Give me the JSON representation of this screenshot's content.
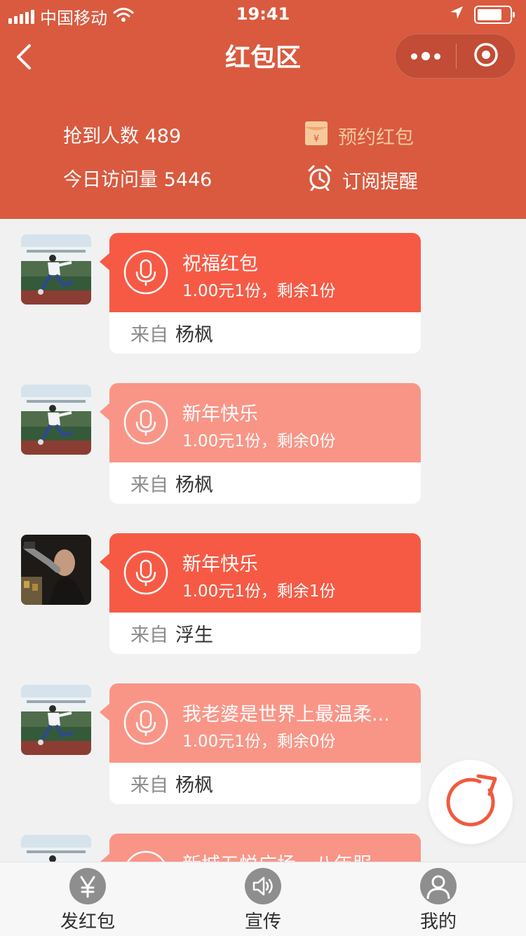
{
  "colors": {
    "header_bg": "#d95a3f",
    "packet_active": "#f65a45",
    "packet_done": "#f99587",
    "reserve_text": "#f6c99c",
    "refresh_ring": "#f05a3e"
  },
  "status_bar": {
    "carrier": "中国移动",
    "time": "19:41",
    "icons": [
      "signal-icon",
      "wifi-icon",
      "location-arrow-icon",
      "battery-icon"
    ]
  },
  "nav": {
    "title": "红包区",
    "back_icon": "chevron-left-icon",
    "menu_icon": "more-dots-icon",
    "close_icon": "target-circle-icon"
  },
  "stats": {
    "grabbed": "抢到人数 489",
    "visits": "今日访问量 5446"
  },
  "actions": {
    "reserve": "预约红包",
    "reserve_icon": "red-envelope-icon",
    "subscribe": "订阅提醒",
    "subscribe_icon": "alarm-clock-icon"
  },
  "packets": [
    {
      "name": "祝福红包",
      "amount": "1.00元1份，剩余1份",
      "from_label": "来自",
      "from": "杨枫",
      "state": "active",
      "avatar": "avatar-soccer-player"
    },
    {
      "name": "新年快乐",
      "amount": "1.00元1份，剩余0份",
      "from_label": "来自",
      "from": "杨枫",
      "state": "done",
      "avatar": "avatar-soccer-player"
    },
    {
      "name": "新年快乐",
      "amount": "1.00元1份，剩余1份",
      "from_label": "来自",
      "from": "浮生",
      "state": "active",
      "avatar": "avatar-man-with-gun"
    },
    {
      "name": "我老婆是世界上最温柔...",
      "amount": "1.00元1份，剩余0份",
      "from_label": "来自",
      "from": "杨枫",
      "state": "done",
      "avatar": "avatar-soccer-player"
    },
    {
      "name": "新城五悦广场，八年服",
      "amount": "",
      "from_label": "",
      "from": "",
      "state": "done",
      "avatar": "avatar-soccer-player"
    }
  ],
  "refresh_icon": "refresh-icon",
  "tabbar": [
    {
      "label": "发红包",
      "icon": "yen-icon"
    },
    {
      "label": "宣传",
      "icon": "speaker-icon"
    },
    {
      "label": "我的",
      "icon": "user-icon"
    }
  ]
}
